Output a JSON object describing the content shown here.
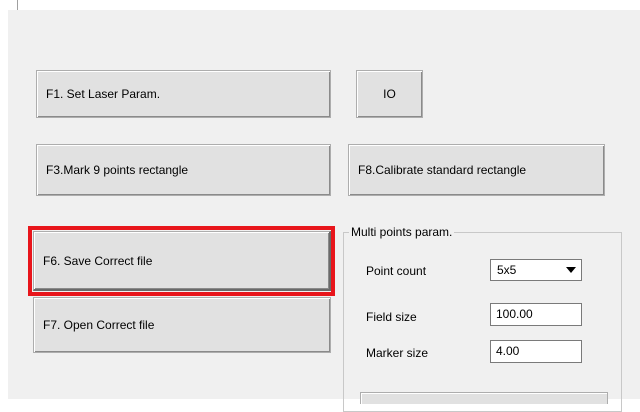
{
  "buttons": {
    "f1": "F1. Set Laser Param.",
    "io": "IO",
    "f3": "F3.Mark 9 points rectangle",
    "f8": "F8.Calibrate standard rectangle",
    "f6": "F6. Save Correct file",
    "f7": "F7. Open Correct file"
  },
  "multi_points": {
    "title": "Multi points param.",
    "point_count_label": "Point count",
    "point_count_value": "5x5",
    "field_size_label": "Field size",
    "field_size_value": "100.00",
    "marker_size_label": "Marker size",
    "marker_size_value": "4.00"
  },
  "colors": {
    "highlight": "#e8151b",
    "panel_bg": "#f0f0f0"
  }
}
